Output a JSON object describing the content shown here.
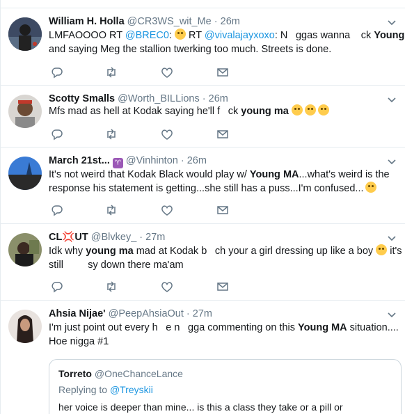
{
  "tweets": [
    {
      "name": "William H. Holla",
      "handle": "@CR3WS_wit_Me",
      "sep": " · ",
      "time": "26m",
      "line1_a": "LMFAOOOO RT ",
      "line1_link1": "@BREC0",
      "line1_b": ": ",
      "line1_c": " RT ",
      "line1_link2": "@vivalajayxoxo",
      "line1_d": ": Nggas wanna ck ",
      "line1_bold": "Young MA",
      "line2": "and saying Meg the stallion twerking too much. Streets is done."
    },
    {
      "name": "Scotty Smalls",
      "handle": "@Worth_BILLions",
      "sep": " · ",
      "time": "26m",
      "line1_a": "Mfs mad as hell at Kodak saying he'll fck ",
      "line1_bold": "young ma"
    },
    {
      "name": "March 21st...",
      "handle": "@Vinhinton",
      "sep": " · ",
      "time": "26m",
      "line1_a": "It's not weird that Kodak Black would play w/ ",
      "line1_bold": "Young MA",
      "line1_b": "...what's weird is the",
      "line2": "response his statement is getting...she still has a puss...I'm confused..."
    },
    {
      "name_a": "CL",
      "name_b": "UT",
      "handle": "@Blvkey_",
      "sep": " · ",
      "time": "27m",
      "line1_a": "Idk why ",
      "line1_bold": "young ma",
      "line1_b": " mad at Kodak bch your a girl dressing up like a boy ",
      "line1_c": " it's",
      "line2": "still   sy down there ma'am"
    },
    {
      "name": "Ahsia Nijae'",
      "handle": "@PeepAhsiaOut",
      "sep": " · ",
      "time": "27m",
      "line1_a": "I'm just point out every he ngga commenting on this ",
      "line1_bold": "Young MA",
      "line1_b": " situation....",
      "line2": "Hoe nigga #1"
    }
  ],
  "quote": {
    "name": "Torreto",
    "handle": "@OneChanceLance",
    "replying_prefix": "Replying to ",
    "replying_to": "@Treyskii",
    "text": "her voice is deeper than mine... is this a class they take or a pill or"
  },
  "colors": {
    "link": "#1b95e0",
    "meta": "#657786",
    "border": "#e6ecf0",
    "name": "#14171a"
  },
  "icons": [
    "reply-icon",
    "retweet-icon",
    "like-icon",
    "dm-icon",
    "chevron-down-icon",
    "emoji-icon"
  ]
}
